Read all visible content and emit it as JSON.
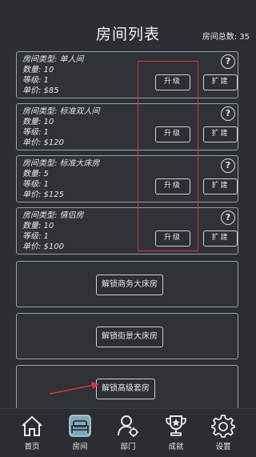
{
  "header": {
    "title": "房间列表",
    "total_label": "房间总数: 35"
  },
  "rooms": [
    {
      "type": "房间类型: 单人间",
      "count": "数量: 10",
      "level": "等级: 1",
      "price": "单价: $85",
      "upgrade_label": "升级",
      "expand_label": "扩建",
      "help": "?"
    },
    {
      "type": "房间类型: 标准双人间",
      "count": "数量: 10",
      "level": "等级: 1",
      "price": "单价: $120",
      "upgrade_label": "升级",
      "expand_label": "扩建",
      "help": "?"
    },
    {
      "type": "房间类型: 标准大床房",
      "count": "数量: 5",
      "level": "等级: 1",
      "price": "单价: $125",
      "upgrade_label": "升级",
      "expand_label": "扩建",
      "help": "?"
    },
    {
      "type": "房间类型: 情侣房",
      "count": "数量: 10",
      "level": "等级: 1",
      "price": "单价: $100",
      "upgrade_label": "升级",
      "expand_label": "扩建",
      "help": "?"
    }
  ],
  "locked": [
    {
      "label": "解锁商务大床房"
    },
    {
      "label": "解锁街景大床房"
    },
    {
      "label": "解锁高级套房"
    }
  ],
  "nav": [
    {
      "label": "首页",
      "icon": "home-icon"
    },
    {
      "label": "房间",
      "icon": "bed-icon",
      "active": true
    },
    {
      "label": "部门",
      "icon": "department-icon"
    },
    {
      "label": "成就",
      "icon": "trophy-icon"
    },
    {
      "label": "设置",
      "icon": "gear-icon"
    }
  ],
  "colors": {
    "background": "#2b2e33",
    "annotation": "#d9363e",
    "active_nav": "#8fb6c8"
  }
}
